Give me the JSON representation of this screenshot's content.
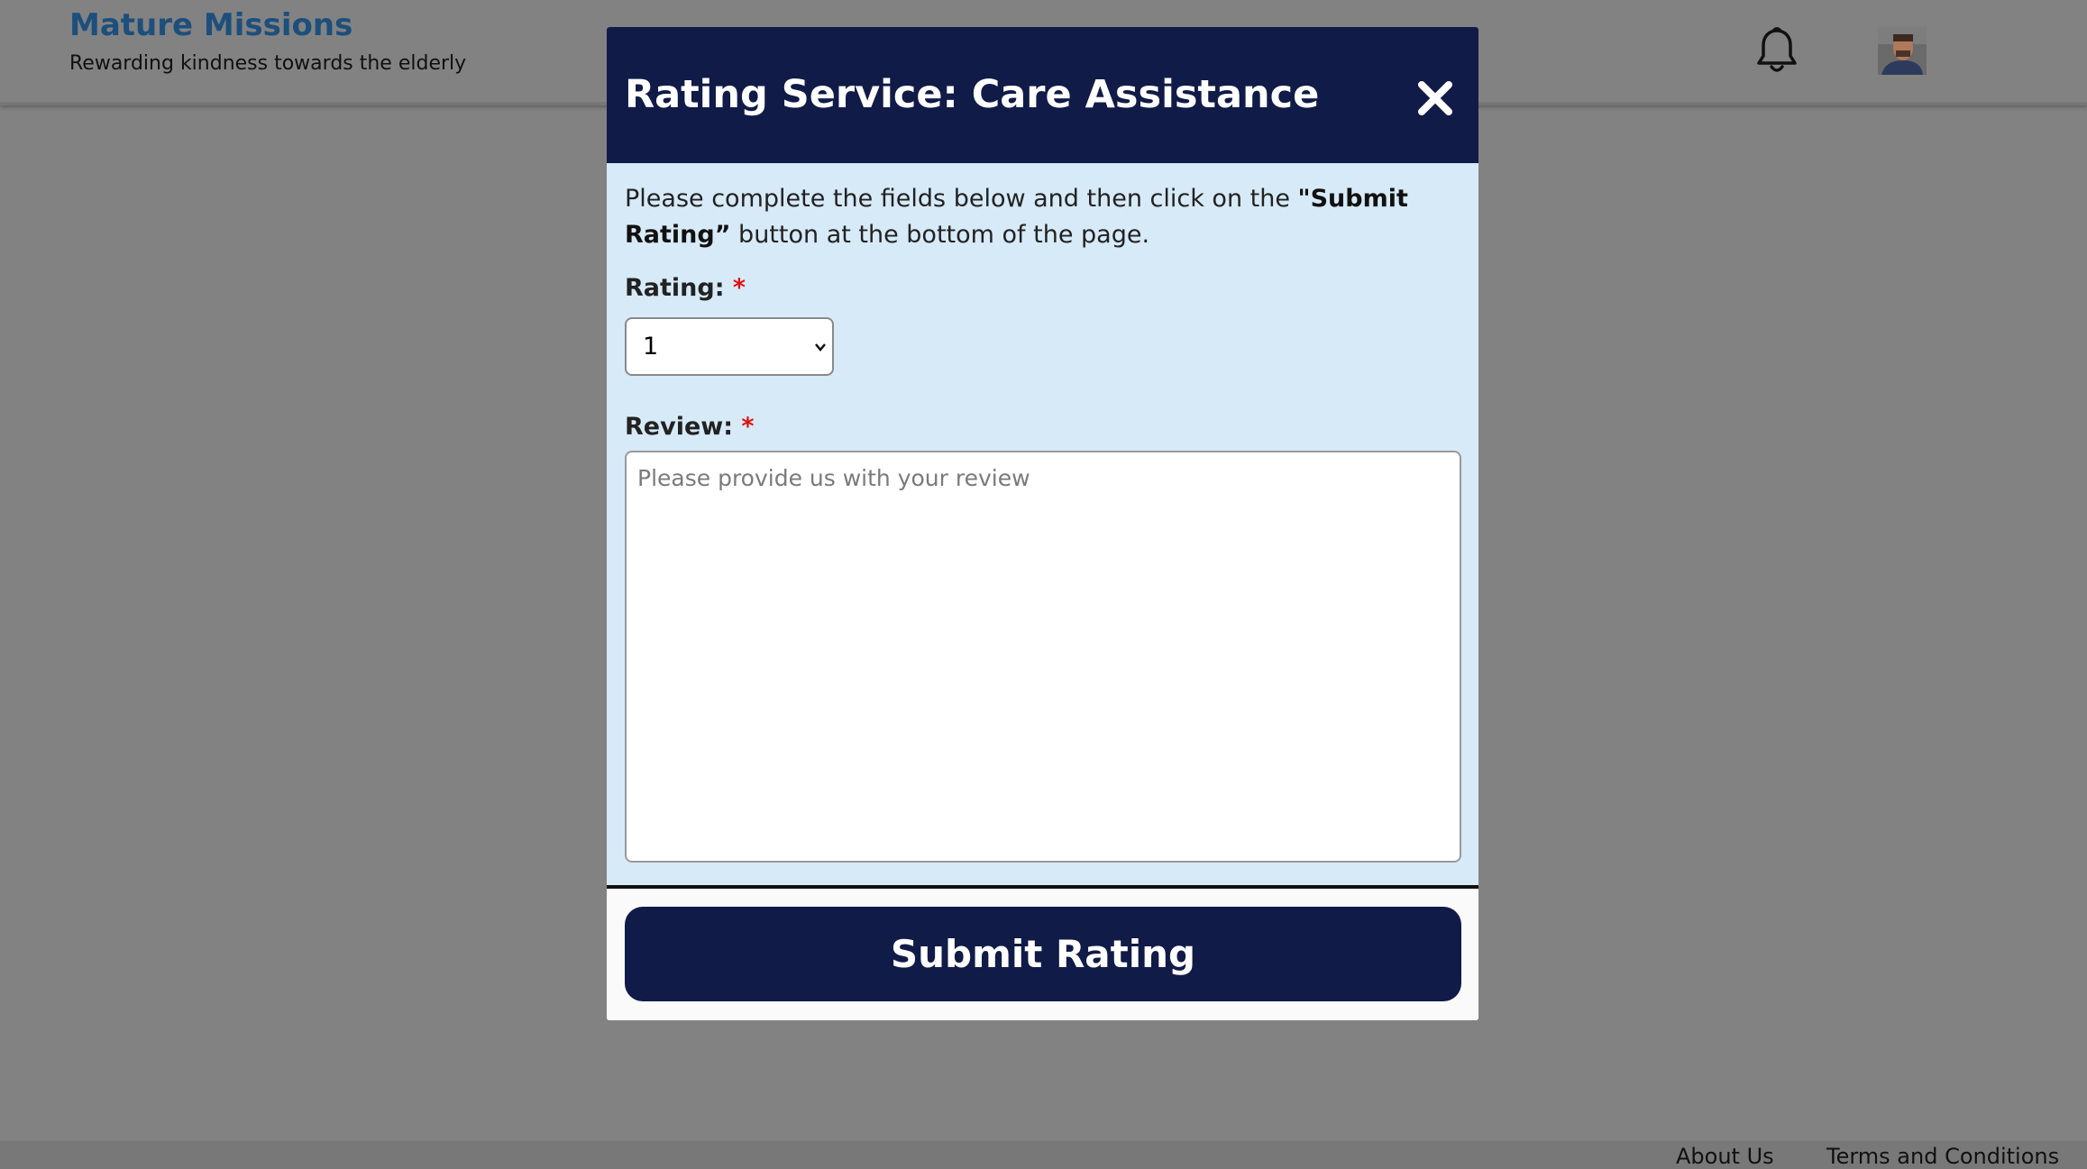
{
  "header": {
    "brand_title": "Mature Missions",
    "brand_tagline": "Rewarding kindness towards the elderly",
    "notification_icon": "bell-icon",
    "avatar_icon": "user-avatar"
  },
  "modal": {
    "title": "Rating Service: Care Assistance",
    "close_icon": "close-icon",
    "instructions_before": "Please complete the fields below and then click on the ",
    "instructions_bold": "\"Submit Rating”",
    "instructions_after": " button at the bottom of the page.",
    "rating_label": "Rating: ",
    "required_marker": "*",
    "rating_selected": "1",
    "review_label": "Review: ",
    "review_placeholder": "Please provide us with your review",
    "review_value": "",
    "submit_label": "Submit Rating"
  },
  "footer": {
    "about_label": "About Us",
    "terms_label": "Terms and Conditions"
  },
  "colors": {
    "overlay_background": "#828282",
    "brand_title": "#1d4f7c",
    "modal_header": "#111b47",
    "modal_body": "#d7eaf8",
    "required": "#e01010",
    "submit_button": "#111b47"
  }
}
